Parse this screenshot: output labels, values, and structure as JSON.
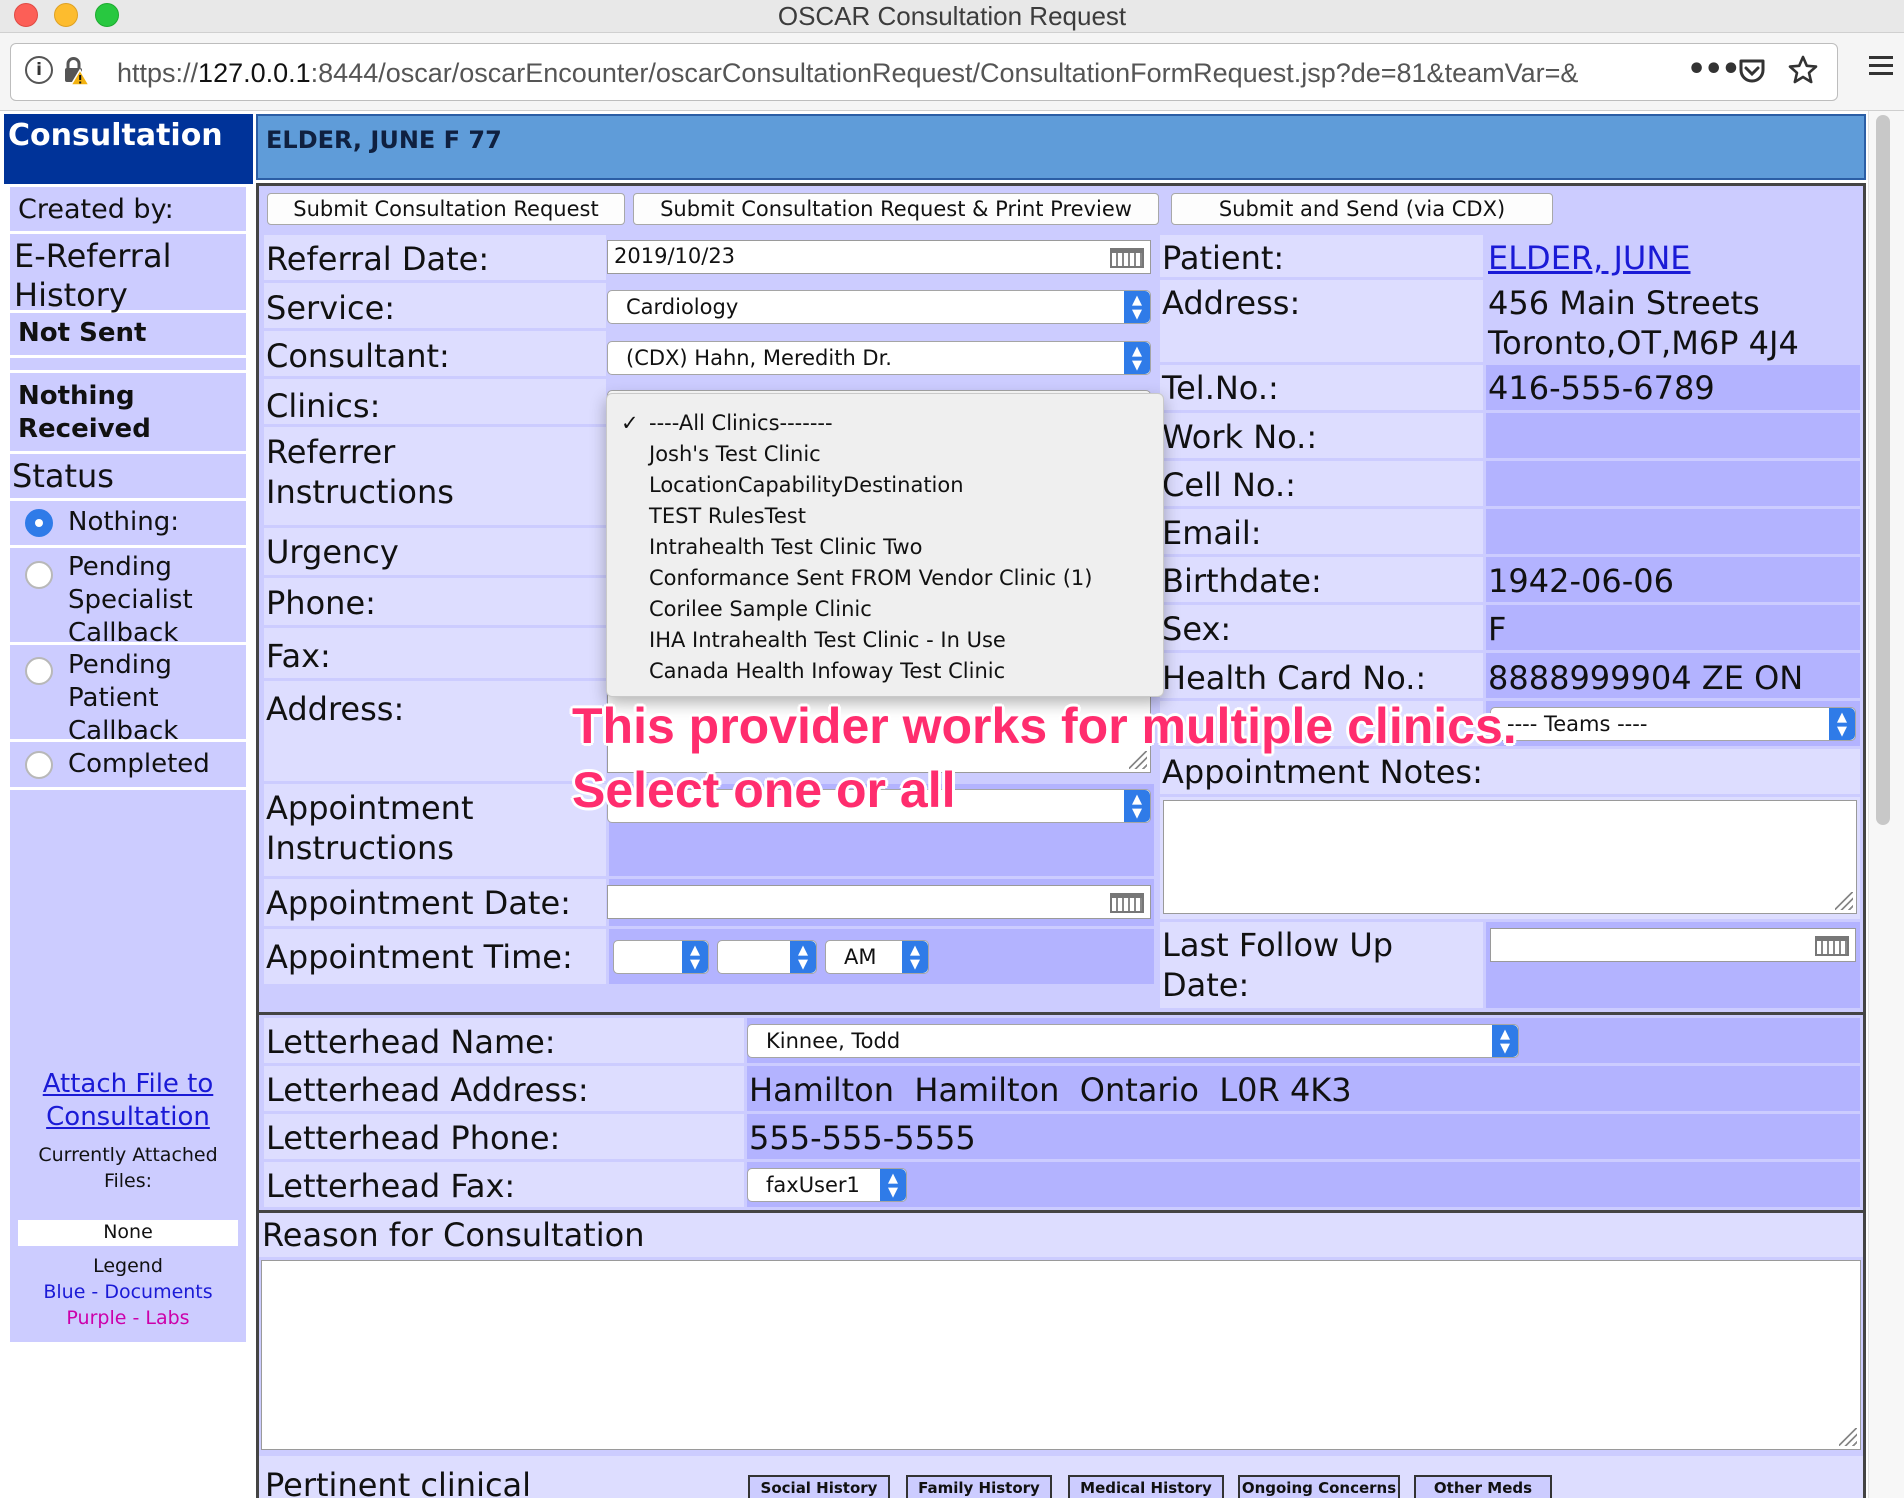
{
  "window": {
    "title": "OSCAR Consultation Request"
  },
  "browser": {
    "url_prefix": "https://",
    "url_host": "127.0.0.1",
    "url_rest": ":8444/oscar/oscarEncounter/oscarConsultationRequest/ConsultationFormRequest.jsp?de=81&teamVar=&",
    "more_icon": "more-horizontal-icon",
    "pocket_icon": "pocket-icon",
    "bookmark_icon": "star-icon",
    "menu_icon": "hamburger-icon"
  },
  "nav": {
    "header": "Consultation",
    "created_by": "Created by:",
    "ereferral_line1": "E-Referral",
    "ereferral_line2": "History",
    "not_sent": "Not Sent",
    "nothing_received_line1": "Nothing",
    "nothing_received_line2": "Received",
    "status": "Status",
    "status_options": [
      {
        "line1": "Nothing:",
        "line2": "",
        "line3": "",
        "selected": true
      },
      {
        "line1": "Pending",
        "line2": "Specialist",
        "line3": "Callback",
        "selected": false
      },
      {
        "line1": "Pending",
        "line2": "Patient",
        "line3": "Callback",
        "selected": false
      },
      {
        "line1": "Completed",
        "line2": "",
        "line3": "",
        "selected": false
      }
    ],
    "attach_line1": "Attach File to",
    "attach_line2": "Consultation",
    "currently_line1": "Currently Attached",
    "currently_line2": "Files:",
    "attached_none": "None",
    "legend": "Legend",
    "legend_blue": "Blue - Documents",
    "legend_purple": "Purple - Labs",
    "colors": {
      "blue": "#1a1ad6",
      "purple": "#cc00aa"
    }
  },
  "patient_header": "ELDER, JUNE F 77",
  "actions": {
    "submit": "Submit Consultation Request",
    "submit_print": "Submit Consultation Request & Print Preview",
    "submit_cdx": "Submit and Send (via CDX)"
  },
  "form": {
    "referral_date_label": "Referral Date:",
    "referral_date_value": "2019/10/23",
    "service_label": "Service:",
    "service_value": "Cardiology",
    "consultant_label": "Consultant:",
    "consultant_value": "(CDX) Hahn, Meredith Dr.",
    "clinics_label": "Clinics:",
    "referrer_line1": "Referrer",
    "referrer_line2": "Instructions",
    "urgency_label": "Urgency",
    "phone_label": "Phone:",
    "fax_label": "Fax:",
    "address_label": "Address:",
    "appt_instr_line1": "Appointment",
    "appt_instr_line2": "Instructions",
    "appt_date_label": "Appointment Date:",
    "appt_time_label": "Appointment Time:",
    "appt_ampm": "AM"
  },
  "clinic_dropdown": {
    "options": [
      "----All Clinics-------",
      "Josh's Test Clinic",
      "LocationCapabilityDestination",
      "TEST RulesTest",
      "Intrahealth Test Clinic Two",
      "Conformance Sent FROM Vendor Clinic (1)",
      "Corilee Sample Clinic",
      "IHA Intrahealth Test Clinic - In Use",
      "Canada Health Infoway Test Clinic"
    ],
    "selected_index": 0,
    "check_mark": "✓"
  },
  "patient": {
    "patient_label": "Patient:",
    "patient_name": "ELDER, JUNE",
    "address_label": "Address:",
    "address_line1": "456 Main Streets",
    "address_line2": "Toronto,OT,M6P 4J4",
    "tel_label": "Tel.No.:",
    "tel_value": "416-555-6789",
    "work_label": "Work No.:",
    "work_value": "",
    "cell_label": "Cell No.:",
    "cell_value": "",
    "email_label": "Email:",
    "email_value": "",
    "birthdate_label": "Birthdate:",
    "birthdate_value": "1942-06-06",
    "sex_label": "Sex:",
    "sex_value": "F",
    "hc_label": "Health Card No.:",
    "hc_value": "8888999904 ZE ON",
    "teams_value": "---- Teams ----",
    "appt_notes_label": "Appointment Notes:",
    "last_followup_line1": "Last Follow Up",
    "last_followup_line2": "Date:"
  },
  "letterhead": {
    "name_label": "Letterhead Name:",
    "name_value": "Kinnee, Todd",
    "address_label": "Letterhead Address:",
    "address_value": "Hamilton  Hamilton  Ontario  L0R 4K3",
    "phone_label": "Letterhead Phone:",
    "phone_value": "555-555-5555",
    "fax_label": "Letterhead Fax:",
    "fax_value": "faxUser1"
  },
  "reason_label": "Reason for Consultation",
  "pertinent_label": "Pertinent clinical",
  "history_tabs": [
    "Social History",
    "Family History",
    "Medical History",
    "Ongoing Concerns",
    "Other Meds"
  ],
  "annotation": {
    "line1": "This provider works for multiple clinics.",
    "line2": "Select one or all",
    "color": "#ff2d6e"
  }
}
